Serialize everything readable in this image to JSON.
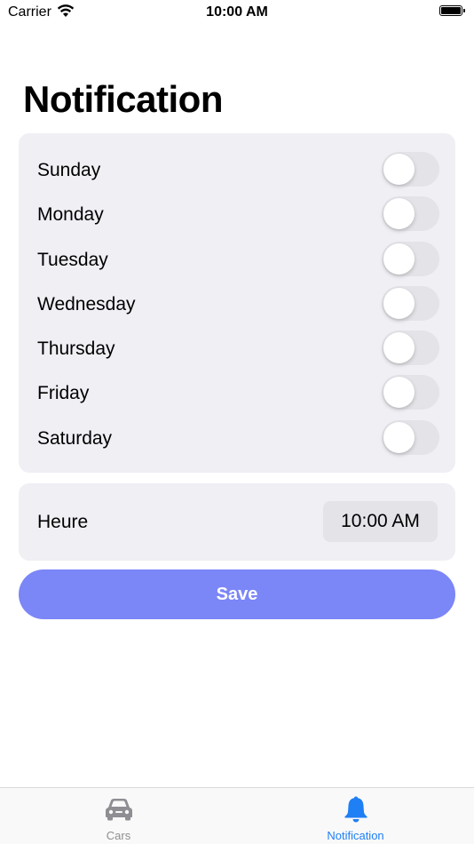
{
  "status_bar": {
    "carrier": "Carrier",
    "time": "10:00 AM"
  },
  "page": {
    "title": "Notification"
  },
  "days": [
    {
      "label": "Sunday",
      "enabled": false
    },
    {
      "label": "Monday",
      "enabled": false
    },
    {
      "label": "Tuesday",
      "enabled": false
    },
    {
      "label": "Wednesday",
      "enabled": false
    },
    {
      "label": "Thursday",
      "enabled": false
    },
    {
      "label": "Friday",
      "enabled": false
    },
    {
      "label": "Saturday",
      "enabled": false
    }
  ],
  "time_setting": {
    "label": "Heure",
    "value": "10:00 AM"
  },
  "save_button": {
    "label": "Save"
  },
  "tab_bar": {
    "tabs": [
      {
        "label": "Cars",
        "icon": "car-icon",
        "active": false
      },
      {
        "label": "Notification",
        "icon": "bell-icon",
        "active": true
      }
    ]
  },
  "colors": {
    "accent": "#1f7ff5",
    "save_button": "#7b86f7",
    "card_background": "#efeff4",
    "toggle_off": "#e3e3e8",
    "tab_inactive": "#8e8e93"
  }
}
